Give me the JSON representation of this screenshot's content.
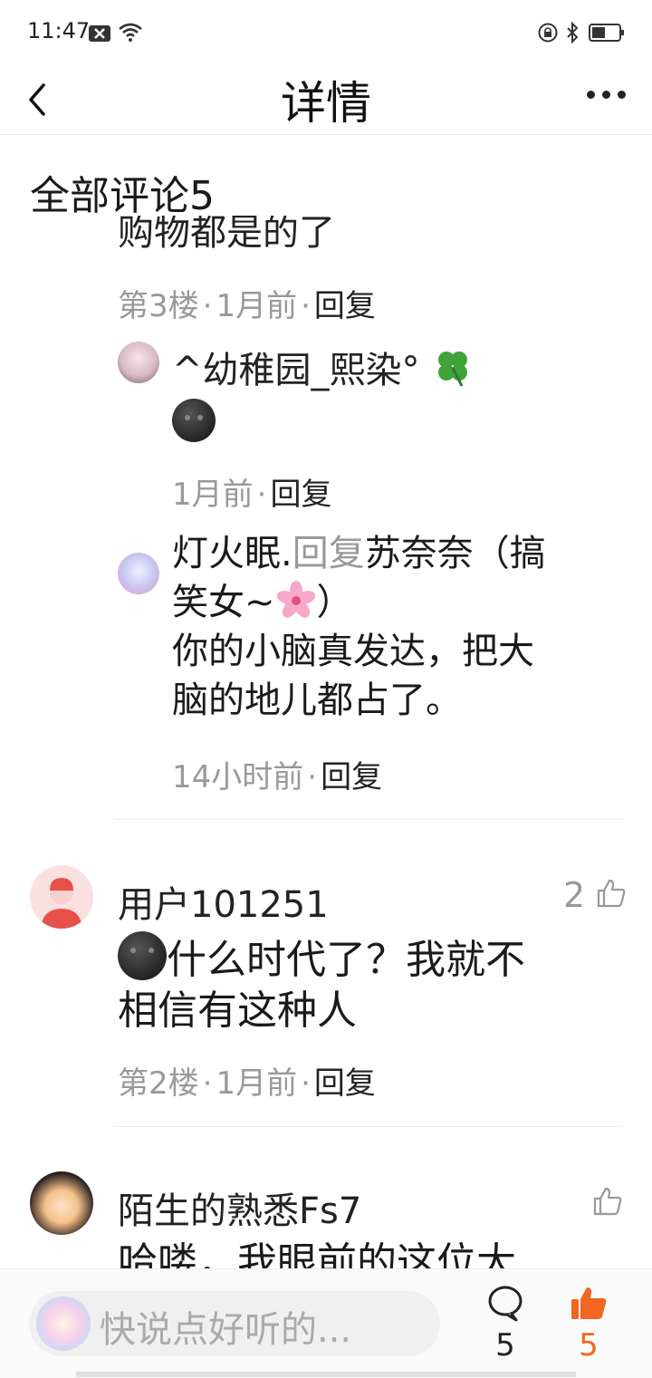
{
  "status_bar": {
    "time": "11:47"
  },
  "header": {
    "title": "详情"
  },
  "section": {
    "title": "全部评论5"
  },
  "floor3": {
    "clipped_text": "购物都是的了",
    "meta": {
      "floor": "第3楼",
      "time": "1月前",
      "reply": "回复"
    }
  },
  "subreplies": [
    {
      "user": "^幼稚园_熙染°",
      "text": "",
      "meta": {
        "time": "1月前",
        "reply": "回复"
      }
    },
    {
      "user": "灯火眠.",
      "reply_word": "回复",
      "target_line1": "苏奈奈（搞",
      "target_line2": "笑女~",
      "target_close": "）",
      "text_line1": "你的小脑真发达，把大",
      "text_line2": "脑的地儿都占了。",
      "meta": {
        "time": "14小时前",
        "reply": "回复"
      }
    }
  ],
  "comments": [
    {
      "user": "用户101251",
      "likes": "2",
      "text_line1": "什么时代了？我就不",
      "text_line2": "相信有这种人",
      "meta": {
        "floor": "第2楼",
        "time": "1月前",
        "reply": "回复"
      }
    },
    {
      "user": "陌生的熟悉Fs7",
      "likes": "",
      "text_clipped": "哈喽，我眼前的这位大"
    }
  ],
  "bottom_bar": {
    "input_placeholder": "快说点好听的...",
    "comment_count": "5",
    "like_count": "5"
  },
  "colors": {
    "accent": "#f26522",
    "meta_gray": "#999999",
    "text": "#1a1a1a"
  }
}
